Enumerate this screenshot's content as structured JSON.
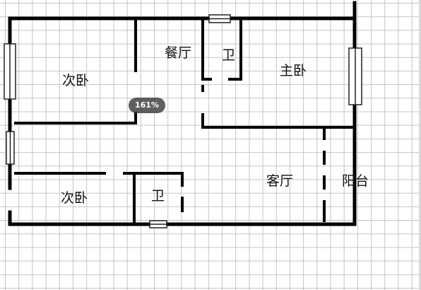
{
  "rooms": {
    "bedroom_top_left": "次卧",
    "dining": "餐厅",
    "bath_top": "卫",
    "master_bedroom": "主卧",
    "bedroom_bottom_left": "次卧",
    "bath_bottom": "卫",
    "living": "客厅",
    "balcony": "阳台"
  },
  "viewer": {
    "zoom": "161%"
  },
  "colors": {
    "wall": "#000000",
    "grid": "#c4c4c4",
    "background": "#ffffff"
  }
}
